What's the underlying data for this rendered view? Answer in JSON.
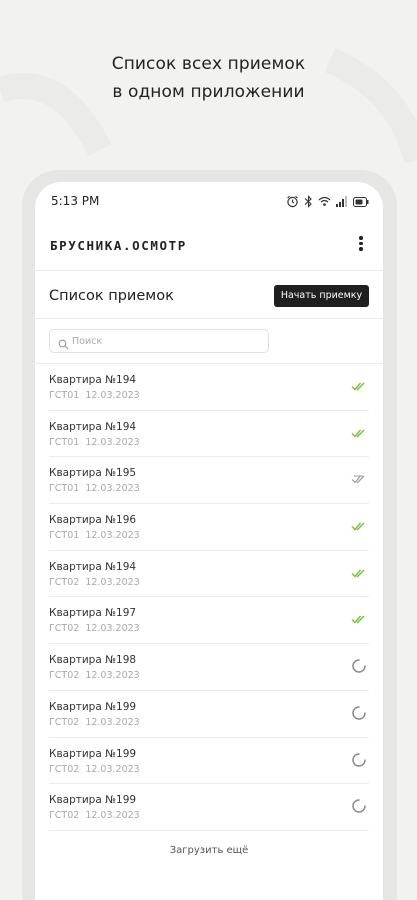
{
  "promo": {
    "line1": "Список всех приемок",
    "line2": "в одном приложении"
  },
  "status_bar": {
    "time": "5:13 PM",
    "icons": [
      "alarm-icon",
      "bluetooth-icon",
      "wifi-icon",
      "signal-icon",
      "battery-icon"
    ]
  },
  "app": {
    "brand": "БРУСНИКА.ОСМОТР",
    "menu_icon": "more-vertical-icon"
  },
  "header": {
    "title": "Список приемок",
    "start_button": "Начать приемку"
  },
  "search": {
    "placeholder": "Поиск",
    "value": ""
  },
  "colors": {
    "accent_green": "#7cc242",
    "button_bg": "#1f1f1f"
  },
  "items": [
    {
      "title": "Квартира №194",
      "code": "ГСТ01",
      "date": "12.03.2023",
      "status": "done"
    },
    {
      "title": "Квартира №194",
      "code": "ГСТ01",
      "date": "12.03.2023",
      "status": "done"
    },
    {
      "title": "Квартира №195",
      "code": "ГСТ01",
      "date": "12.03.2023",
      "status": "partial"
    },
    {
      "title": "Квартира №196",
      "code": "ГСТ01",
      "date": "12.03.2023",
      "status": "done"
    },
    {
      "title": "Квартира №194",
      "code": "ГСТ02",
      "date": "12.03.2023",
      "status": "done"
    },
    {
      "title": "Квартира №197",
      "code": "ГСТ02",
      "date": "12.03.2023",
      "status": "done"
    },
    {
      "title": "Квартира №198",
      "code": "ГСТ02",
      "date": "12.03.2023",
      "status": "loading"
    },
    {
      "title": "Квартира №199",
      "code": "ГСТ02",
      "date": "12.03.2023",
      "status": "loading"
    },
    {
      "title": "Квартира №199",
      "code": "ГСТ02",
      "date": "12.03.2023",
      "status": "loading"
    },
    {
      "title": "Квартира №199",
      "code": "ГСТ02",
      "date": "12.03.2023",
      "status": "loading"
    }
  ],
  "load_more": "Загрузить ещё"
}
